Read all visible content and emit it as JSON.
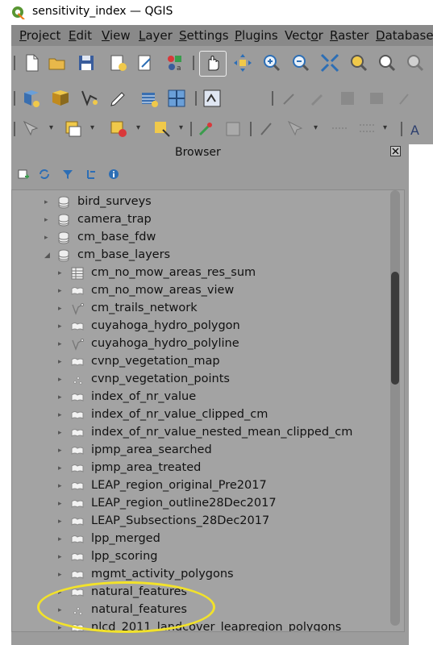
{
  "window": {
    "title": "sensitivity_index — QGIS"
  },
  "menu": [
    {
      "label": "Project",
      "underline_index": 0
    },
    {
      "label": "Edit",
      "underline_index": 0
    },
    {
      "label": "View",
      "underline_index": 0
    },
    {
      "label": "Layer",
      "underline_index": 0
    },
    {
      "label": "Settings",
      "underline_index": 0
    },
    {
      "label": "Plugins",
      "underline_index": 0
    },
    {
      "label": "Vector",
      "underline_index": 4
    },
    {
      "label": "Raster",
      "underline_index": 0
    },
    {
      "label": "Database",
      "underline_index": 0
    }
  ],
  "browser": {
    "title": "Browser",
    "items": [
      {
        "label": "bird_surveys",
        "icon": "database-icon",
        "level": 0,
        "expanded": false
      },
      {
        "label": "camera_trap",
        "icon": "database-icon",
        "level": 0,
        "expanded": false
      },
      {
        "label": "cm_base_fdw",
        "icon": "database-icon",
        "level": 0,
        "expanded": false
      },
      {
        "label": "cm_base_layers",
        "icon": "database-icon",
        "level": 0,
        "expanded": true
      },
      {
        "label": "cm_no_mow_areas_res_sum",
        "icon": "table-icon",
        "level": 1
      },
      {
        "label": "cm_no_mow_areas_view",
        "icon": "polygon-layer-icon",
        "level": 1
      },
      {
        "label": "cm_trails_network",
        "icon": "line-layer-icon",
        "level": 1
      },
      {
        "label": "cuyahoga_hydro_polygon",
        "icon": "polygon-layer-icon",
        "level": 1
      },
      {
        "label": "cuyahoga_hydro_polyline",
        "icon": "line-layer-icon",
        "level": 1
      },
      {
        "label": "cvnp_vegetation_map",
        "icon": "polygon-layer-icon",
        "level": 1
      },
      {
        "label": "cvnp_vegetation_points",
        "icon": "point-layer-icon",
        "level": 1
      },
      {
        "label": "index_of_nr_value",
        "icon": "polygon-layer-icon",
        "level": 1
      },
      {
        "label": "index_of_nr_value_clipped_cm",
        "icon": "polygon-layer-icon",
        "level": 1
      },
      {
        "label": "index_of_nr_value_nested_mean_clipped_cm",
        "icon": "polygon-layer-icon",
        "level": 1
      },
      {
        "label": "ipmp_area_searched",
        "icon": "polygon-layer-icon",
        "level": 1
      },
      {
        "label": "ipmp_area_treated",
        "icon": "polygon-layer-icon",
        "level": 1
      },
      {
        "label": "LEAP_region_original_Pre2017",
        "icon": "polygon-layer-icon",
        "level": 1
      },
      {
        "label": "LEAP_region_outline28Dec2017",
        "icon": "polygon-layer-icon",
        "level": 1
      },
      {
        "label": "LEAP_Subsections_28Dec2017",
        "icon": "polygon-layer-icon",
        "level": 1
      },
      {
        "label": "lpp_merged",
        "icon": "polygon-layer-icon",
        "level": 1
      },
      {
        "label": "lpp_scoring",
        "icon": "polygon-layer-icon",
        "level": 1
      },
      {
        "label": "mgmt_activity_polygons",
        "icon": "polygon-layer-icon",
        "level": 1
      },
      {
        "label": "natural_features",
        "icon": "polygon-layer-icon",
        "level": 1
      },
      {
        "label": "natural_features",
        "icon": "point-layer-icon",
        "level": 1
      },
      {
        "label": "nlcd_2011_landcover_leapregion_polygons",
        "icon": "polygon-layer-icon",
        "level": 1
      }
    ]
  },
  "colors": {
    "highlight": "#f2e22a",
    "panel": "#9c9c9c"
  }
}
